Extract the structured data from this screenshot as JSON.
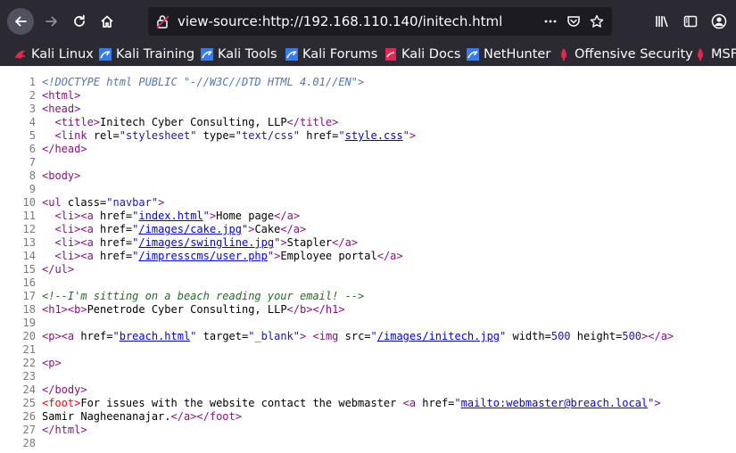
{
  "url": "view-source:http://192.168.110.140/initech.html",
  "bookmarks": [
    "Kali Linux",
    "Kali Training",
    "Kali Tools",
    "Kali Forums",
    "Kali Docs",
    "NetHunter",
    "Offensive Security",
    "MSF"
  ],
  "colors": {
    "toolbar": "#2b2a33",
    "tag": "#881280",
    "value": "#1a1aa6",
    "link": "#0000ee",
    "comment": "#236e25",
    "doctype": "#4a79b6",
    "error": "#ff0000"
  },
  "icons": {
    "back": "arrow-left-icon",
    "forward": "arrow-right-icon",
    "reload": "reload-icon",
    "home": "home-icon",
    "site": "broken-lock-icon",
    "more": "ellipsis-icon",
    "pocket": "pocket-icon",
    "bookmark": "star-icon",
    "library": "library-icon",
    "sidebar": "sidebar-icon",
    "account": "account-icon",
    "menu": "hamburger-icon"
  },
  "source_lines": [
    {
      "n": "1",
      "t": [
        {
          "c": "doctype",
          "s": "<!DOCTYPE html PUBLIC \"-//W3C//DTD HTML 4.01//EN\">"
        }
      ]
    },
    {
      "n": "2",
      "t": [
        {
          "c": "tag",
          "s": "<html>"
        }
      ]
    },
    {
      "n": "3",
      "t": [
        {
          "c": "tag",
          "s": "<head>"
        }
      ]
    },
    {
      "n": "4",
      "t": [
        {
          "c": "",
          "s": "  "
        },
        {
          "c": "tag",
          "s": "<title>"
        },
        {
          "c": "",
          "s": "Initech Cyber Consulting, LLP"
        },
        {
          "c": "tag",
          "s": "</title>"
        }
      ]
    },
    {
      "n": "5",
      "t": [
        {
          "c": "",
          "s": "  "
        },
        {
          "c": "tag",
          "s": "<link "
        },
        {
          "c": "attr",
          "s": "rel="
        },
        {
          "c": "val",
          "s": "\"stylesheet\""
        },
        {
          "c": "attr",
          "s": " type="
        },
        {
          "c": "val",
          "s": "\"text/css\""
        },
        {
          "c": "attr",
          "s": " href="
        },
        {
          "c": "val",
          "s": "\""
        },
        {
          "c": "link",
          "s": "style.css"
        },
        {
          "c": "val",
          "s": "\""
        },
        {
          "c": "tag",
          "s": ">"
        }
      ]
    },
    {
      "n": "6",
      "t": [
        {
          "c": "tag",
          "s": "</head>"
        }
      ]
    },
    {
      "n": "7",
      "t": []
    },
    {
      "n": "8",
      "t": [
        {
          "c": "tag",
          "s": "<body>"
        }
      ]
    },
    {
      "n": "9",
      "t": []
    },
    {
      "n": "10",
      "t": [
        {
          "c": "tag",
          "s": "<ul "
        },
        {
          "c": "attr",
          "s": "class="
        },
        {
          "c": "val",
          "s": "\"navbar\""
        },
        {
          "c": "tag",
          "s": ">"
        }
      ]
    },
    {
      "n": "11",
      "t": [
        {
          "c": "",
          "s": "  "
        },
        {
          "c": "tag",
          "s": "<li><a "
        },
        {
          "c": "attr",
          "s": "href="
        },
        {
          "c": "val",
          "s": "\""
        },
        {
          "c": "link",
          "s": "index.html"
        },
        {
          "c": "val",
          "s": "\""
        },
        {
          "c": "tag",
          "s": ">"
        },
        {
          "c": "",
          "s": "Home page"
        },
        {
          "c": "tag",
          "s": "</a>"
        }
      ]
    },
    {
      "n": "12",
      "t": [
        {
          "c": "",
          "s": "  "
        },
        {
          "c": "tag",
          "s": "<li><a "
        },
        {
          "c": "attr",
          "s": "href="
        },
        {
          "c": "val",
          "s": "\""
        },
        {
          "c": "link",
          "s": "/images/cake.jpg"
        },
        {
          "c": "val",
          "s": "\""
        },
        {
          "c": "tag",
          "s": ">"
        },
        {
          "c": "",
          "s": "Cake"
        },
        {
          "c": "tag",
          "s": "</a>"
        }
      ]
    },
    {
      "n": "13",
      "t": [
        {
          "c": "",
          "s": "  "
        },
        {
          "c": "tag",
          "s": "<li><a "
        },
        {
          "c": "attr",
          "s": "href="
        },
        {
          "c": "val",
          "s": "\""
        },
        {
          "c": "link",
          "s": "/images/swingline.jpg"
        },
        {
          "c": "val",
          "s": "\""
        },
        {
          "c": "tag",
          "s": ">"
        },
        {
          "c": "",
          "s": "Stapler"
        },
        {
          "c": "tag",
          "s": "</a>"
        }
      ]
    },
    {
      "n": "14",
      "t": [
        {
          "c": "",
          "s": "  "
        },
        {
          "c": "tag",
          "s": "<li><a "
        },
        {
          "c": "attr",
          "s": "href="
        },
        {
          "c": "val",
          "s": "\""
        },
        {
          "c": "link",
          "s": "/impresscms/user.php"
        },
        {
          "c": "val",
          "s": "\""
        },
        {
          "c": "tag",
          "s": ">"
        },
        {
          "c": "",
          "s": "Employee portal"
        },
        {
          "c": "tag",
          "s": "</a>"
        }
      ]
    },
    {
      "n": "15",
      "t": [
        {
          "c": "tag",
          "s": "</ul>"
        }
      ]
    },
    {
      "n": "16",
      "t": []
    },
    {
      "n": "17",
      "t": [
        {
          "c": "comment",
          "s": "<!--I'm sitting on a beach reading your email! -->"
        }
      ]
    },
    {
      "n": "18",
      "t": [
        {
          "c": "tag",
          "s": "<h1><b>"
        },
        {
          "c": "",
          "s": "Penetrode Cyber Consulting, LLP"
        },
        {
          "c": "tag",
          "s": "</b></h1>"
        }
      ]
    },
    {
      "n": "19",
      "t": []
    },
    {
      "n": "20",
      "t": [
        {
          "c": "tag",
          "s": "<p><a "
        },
        {
          "c": "attr",
          "s": "href="
        },
        {
          "c": "val",
          "s": "\""
        },
        {
          "c": "link",
          "s": "breach.html"
        },
        {
          "c": "val",
          "s": "\""
        },
        {
          "c": "attr",
          "s": " target="
        },
        {
          "c": "val",
          "s": "\"_blank\""
        },
        {
          "c": "tag",
          "s": ">"
        },
        {
          "c": "",
          "s": " "
        },
        {
          "c": "tag",
          "s": "<img "
        },
        {
          "c": "attr",
          "s": "src="
        },
        {
          "c": "val",
          "s": "\""
        },
        {
          "c": "link",
          "s": "/images/initech.jpg"
        },
        {
          "c": "val",
          "s": "\""
        },
        {
          "c": "attr",
          "s": " width="
        },
        {
          "c": "val",
          "s": "500"
        },
        {
          "c": "attr",
          "s": " height="
        },
        {
          "c": "val",
          "s": "500"
        },
        {
          "c": "tag",
          "s": "></a>"
        }
      ]
    },
    {
      "n": "21",
      "t": []
    },
    {
      "n": "22",
      "t": [
        {
          "c": "tag",
          "s": "<p>"
        }
      ]
    },
    {
      "n": "23",
      "t": []
    },
    {
      "n": "24",
      "t": [
        {
          "c": "tag",
          "s": "</body>"
        }
      ]
    },
    {
      "n": "25",
      "t": [
        {
          "c": "err",
          "s": "<foot>"
        },
        {
          "c": "",
          "s": "For issues with the website contact the webmaster "
        },
        {
          "c": "tag",
          "s": "<a "
        },
        {
          "c": "attr",
          "s": "href="
        },
        {
          "c": "val",
          "s": "\""
        },
        {
          "c": "link",
          "s": "mailto:webmaster@breach.local"
        },
        {
          "c": "val",
          "s": "\""
        },
        {
          "c": "tag",
          "s": ">"
        }
      ]
    },
    {
      "n": "26",
      "t": [
        {
          "c": "",
          "s": "Samir Nagheenanajar."
        },
        {
          "c": "tag",
          "s": "</a></foot>"
        }
      ]
    },
    {
      "n": "27",
      "t": [
        {
          "c": "tag",
          "s": "</html>"
        }
      ]
    },
    {
      "n": "28",
      "t": []
    }
  ]
}
